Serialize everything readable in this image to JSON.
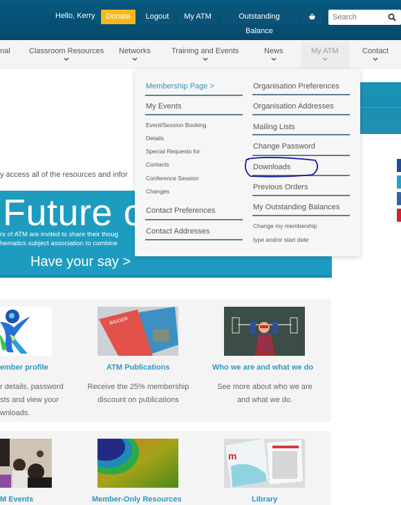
{
  "topbar": {
    "greeting": "Hello, Kerry",
    "donate_label": "Donate",
    "logout_label": "Logout",
    "my_atm_label": "My ATM",
    "outstanding_balance_label": "Outstanding Balance",
    "search_placeholder": "Search",
    "colors": {
      "bar": "#06597f",
      "donate": "#f5b91a"
    }
  },
  "nav": {
    "items": [
      {
        "label": "nal"
      },
      {
        "label": "Classroom Resources"
      },
      {
        "label": "Networks"
      },
      {
        "label": "Training and Events"
      },
      {
        "label": "News"
      },
      {
        "label": "My ATM",
        "active": true
      },
      {
        "label": "Contact"
      }
    ]
  },
  "dropdown": {
    "left": {
      "membership_page": "Membership Page >",
      "my_events": "My Events",
      "sub_items": [
        "Event/Session Booking",
        "Details",
        "Special Requests for",
        "Contacts",
        "Conference Session",
        "Changes"
      ],
      "contact_preferences": "Contact Preferences",
      "contact_addresses": "Contact Addresses"
    },
    "right": {
      "items": [
        "Organisation Preferences",
        "Organisation Addresses",
        "Mailing Lists",
        "Change Password",
        "Downloads",
        "Previous Orders",
        "My Outstanding Balances"
      ],
      "change_membership_line1": "Change my membership",
      "change_membership_line2": "type and/or start date"
    },
    "highlighted": "Downloads"
  },
  "intro_text": "y access all of the resources and infor",
  "banner": {
    "headline": "Future c",
    "line1": "rs of ATM are invited to share their thoug",
    "line2": "hematics subject association to combine",
    "cta": "Have your say >",
    "color": "#1e9cc0"
  },
  "cards": [
    {
      "title": "ember profile",
      "desc": [
        "r details, password",
        "sts and view your",
        "wnloads."
      ]
    },
    {
      "title": "ATM Publications",
      "desc": [
        "Receive the 25% membership",
        "discount on publications"
      ]
    },
    {
      "title": "Who we are and what we do",
      "desc": [
        "See more about who we are",
        "and what we do."
      ]
    },
    {
      "title": "M Events"
    },
    {
      "title": "Member-Only Resources"
    },
    {
      "title": "Library"
    }
  ],
  "social": [
    "facebook-icon",
    "twitter-icon",
    "linkedin-icon",
    "youtube-icon"
  ]
}
